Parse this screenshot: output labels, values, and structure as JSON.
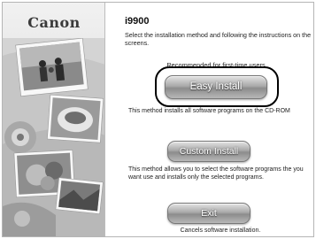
{
  "app": {
    "brand": "Canon",
    "model": "i9900",
    "instructions": "Select the installation method and following the instructions on the screens."
  },
  "recommended_label": "Recommended for first-time users",
  "buttons": {
    "easy_install": {
      "label": "Easy Install",
      "description": "This method installs all software programs on the CD-ROM"
    },
    "custom_install": {
      "label": "Custom Install",
      "description": "This method allows you to select the software programs the you want use and installs only the selected programs."
    },
    "exit": {
      "label": "Exit",
      "description": "Cancels software installation."
    }
  },
  "colors": {
    "button_gradient_top": "#e4e4e4",
    "button_gradient_bottom": "#8c8c8c",
    "highlight_ring": "#000000"
  }
}
